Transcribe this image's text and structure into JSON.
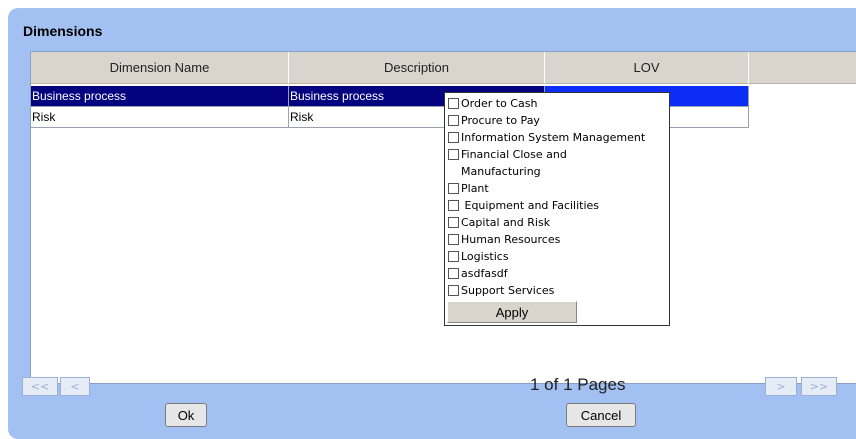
{
  "panel": {
    "title": "Dimensions"
  },
  "table": {
    "headers": [
      "Dimension Name",
      "Description",
      "LOV",
      ""
    ],
    "rows": [
      {
        "name": "Business process",
        "description": "Business process",
        "lov": "",
        "selected": true
      },
      {
        "name": "Risk",
        "description": "Risk",
        "lov": "",
        "selected": false
      }
    ]
  },
  "lov_popup": {
    "options": [
      "Order to Cash",
      "Procure to Pay",
      "Information System Management",
      "Financial Close and",
      "Manufacturing",
      "Plant",
      " Equipment and Facilities",
      "Capital and Risk",
      "Human Resources",
      "Logistics",
      "asdfasdf",
      "Support Services"
    ],
    "apply_label": "Apply"
  },
  "pagination": {
    "first_label": "<<",
    "prev_label": "<",
    "next_label": ">",
    "last_label": ">>",
    "status": "1 of 1 Pages"
  },
  "footer": {
    "ok_label": "Ok",
    "cancel_label": "Cancel"
  },
  "colors": {
    "panel_bg": "#a3c0f3",
    "selected_row": "#05027f",
    "selected_lov": "#0b2df5",
    "header_bg": "#d9d5cd"
  }
}
